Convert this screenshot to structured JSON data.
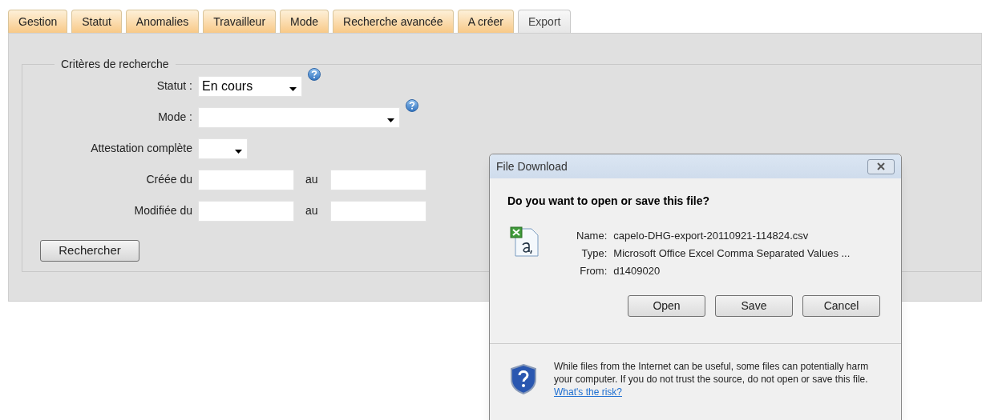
{
  "tabs": [
    {
      "label": "Gestion",
      "selected": false
    },
    {
      "label": "Statut",
      "selected": false
    },
    {
      "label": "Anomalies",
      "selected": false
    },
    {
      "label": "Travailleur",
      "selected": false
    },
    {
      "label": "Mode",
      "selected": false
    },
    {
      "label": "Recherche avancée",
      "selected": false
    },
    {
      "label": "A créer",
      "selected": false
    },
    {
      "label": "Export",
      "selected": true
    }
  ],
  "search_criteria": {
    "legend": "Critères de recherche",
    "fields": [
      {
        "kind": "select",
        "label": "Statut :",
        "value": "En cours",
        "help": true
      },
      {
        "kind": "select",
        "label": "Mode :",
        "help": true
      },
      {
        "kind": "select",
        "label": "Attestation complète",
        "help": false
      },
      {
        "kind": "range",
        "label": "Créée du",
        "separator": "au"
      },
      {
        "kind": "range",
        "label": "Modifiée du",
        "separator": "au"
      }
    ],
    "button": "Rechercher"
  },
  "dialog": {
    "title": "File Download",
    "question": "Do you want to open or save this file?",
    "details": [
      {
        "label": "Name:",
        "value": "capelo-DHG-export-20110921-114824.csv"
      },
      {
        "label": "Type:",
        "value": "Microsoft Office Excel Comma Separated Values ..."
      },
      {
        "label": "From:",
        "value": "d1409020"
      }
    ],
    "buttons": [
      "Open",
      "Save",
      "Cancel"
    ],
    "warning": "While files from the Internet can be useful, some files can potentially harm your computer. If you do not trust the source, do not open or save this file.",
    "link": "What's the risk?"
  }
}
